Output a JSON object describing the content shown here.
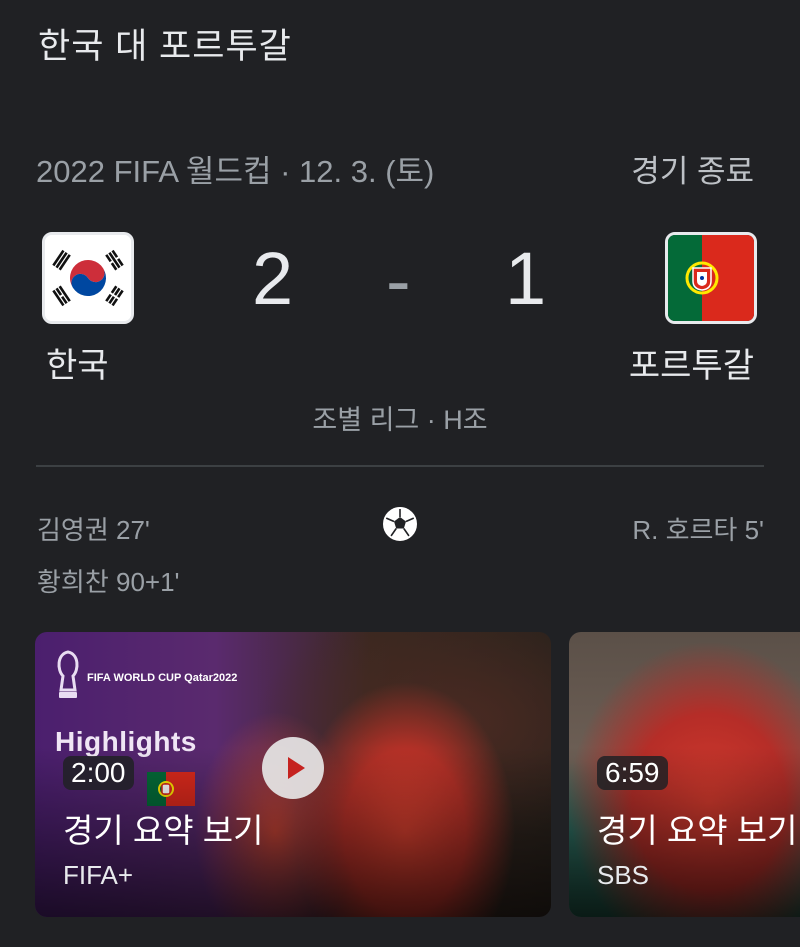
{
  "header": {
    "title": "한국 대 포르투갈"
  },
  "match": {
    "meta": "2022 FIFA 월드컵 · 12. 3. (토)",
    "status": "경기 종료",
    "home": {
      "name": "한국",
      "score": "2",
      "flag_icon": "south-korea-flag-icon"
    },
    "away": {
      "name": "포르투갈",
      "score": "1",
      "flag_icon": "portugal-flag-icon"
    },
    "separator": "-",
    "stage": "조별 리그 · H조"
  },
  "goals": {
    "home": [
      "김영권 27'",
      "황희찬 90+1'"
    ],
    "away": [
      "R. 호르타 5'"
    ],
    "icon": "soccer-ball-icon"
  },
  "videos": [
    {
      "duration": "2:00",
      "title": "경기 요약 보기",
      "source": "FIFA+",
      "thumb_text": "Highlights",
      "thumb_brand": "FIFA WORLD CUP Qatar2022"
    },
    {
      "duration": "6:59",
      "title": "경기 요약 보기",
      "source": "SBS"
    }
  ],
  "colors": {
    "background": "#202124",
    "text_primary": "#e8eaed",
    "text_secondary": "#9aa0a6",
    "divider": "#3c4043"
  }
}
